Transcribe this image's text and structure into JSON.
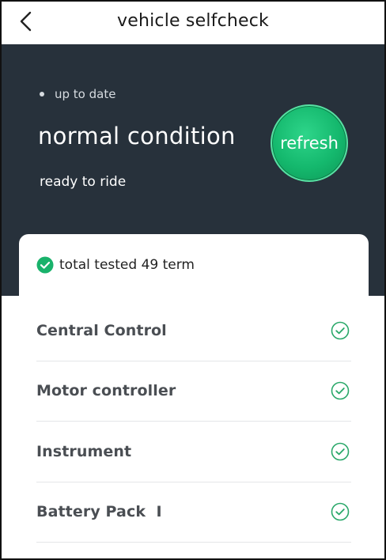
{
  "header": {
    "title": "vehicle selfcheck"
  },
  "hero": {
    "status_line": "up to date",
    "condition": "normal condition",
    "subtitle": "ready to ride",
    "refresh_label": "refresh"
  },
  "summary": {
    "text": "total tested 49 term"
  },
  "items": [
    {
      "label": "Central Control",
      "status": "ok"
    },
    {
      "label": "Motor controller",
      "status": "ok"
    },
    {
      "label": "Instrument",
      "status": "ok"
    },
    {
      "label": "Battery Pack  I",
      "status": "ok"
    }
  ],
  "colors": {
    "hero_bg": "#27313b",
    "accent_green": "#14b86d",
    "check_green": "#2aa86a"
  }
}
